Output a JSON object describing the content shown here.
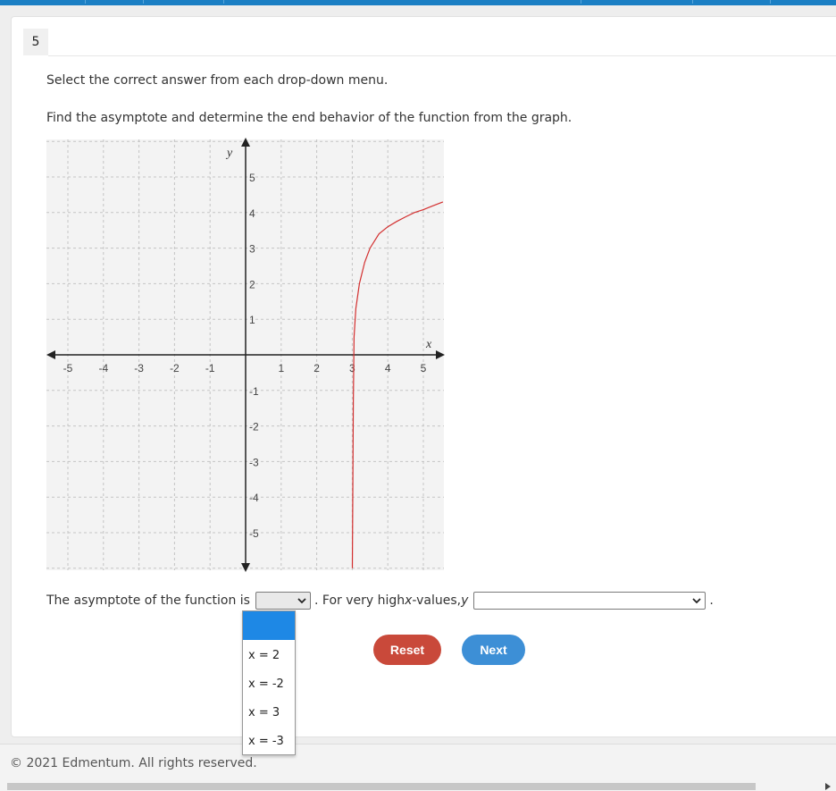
{
  "question": {
    "number": "5",
    "instruction": "Select the correct answer from each drop-down menu.",
    "prompt": "Find the asymptote and determine the end behavior of the function from the graph."
  },
  "chart_data": {
    "type": "line",
    "xlabel": "x",
    "ylabel": "y",
    "xlim": [
      -5.5,
      5.6
    ],
    "ylim": [
      -6,
      6
    ],
    "x_ticks": [
      "-5",
      "-4",
      "-3",
      "-2",
      "-1",
      "1",
      "2",
      "3",
      "4",
      "5"
    ],
    "y_ticks": [
      "5",
      "4",
      "3",
      "2",
      "1",
      "-1",
      "-2",
      "-3",
      "-4",
      "-5"
    ],
    "grid": true,
    "series": [
      {
        "color": "#d32f2f",
        "x": [
          3.002,
          3.01,
          3.03,
          3.05,
          3.1,
          3.2,
          3.35,
          3.5,
          3.75,
          4.0,
          4.25,
          4.5,
          4.75,
          5.0,
          5.25,
          5.55
        ],
        "y": [
          -6.0,
          -4.7,
          -1.3,
          0.5,
          1.3,
          2.0,
          2.6,
          3.0,
          3.4,
          3.6,
          3.75,
          3.88,
          4.0,
          4.08,
          4.18,
          4.3
        ]
      }
    ],
    "line_color": "#d32f2f"
  },
  "answer": {
    "part1": "The asymptote of the function is",
    "part2": ". For very high ",
    "x_word": "x",
    "part3": "-values, ",
    "y_word": "y",
    "end": ".",
    "dropdown1_value": "",
    "dropdown1_options": [
      "",
      "x = 2",
      "x = -2",
      "x = 3",
      "x = -3"
    ],
    "dropdown2_value": ""
  },
  "buttons": {
    "reset": "Reset",
    "next": "Next"
  },
  "footer": {
    "copyright": "© 2021 Edmentum. All rights reserved."
  }
}
